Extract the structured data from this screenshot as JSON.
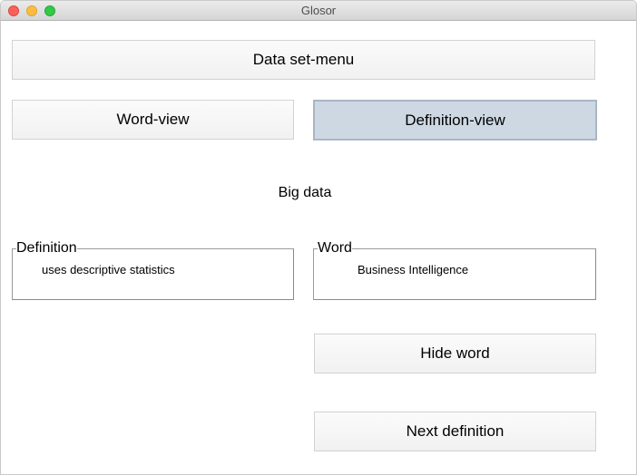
{
  "window": {
    "title": "Glosor"
  },
  "buttons": {
    "data_set_menu": "Data set-menu",
    "word_view": "Word-view",
    "definition_view": "Definition-view",
    "hide_word": "Hide word",
    "next_definition": "Next definition"
  },
  "main": {
    "heading": "Big data",
    "definition_box": {
      "label": "Definition",
      "text": "uses descriptive statistics"
    },
    "word_box": {
      "label": "Word",
      "text": "Business Intelligence"
    }
  },
  "colors": {
    "selected_button_bg": "#cdd8e3",
    "selected_button_border": "#a9b6c4",
    "close_light": "#fc605b",
    "minimize_light": "#fdbc40",
    "maximize_light": "#34c84a"
  }
}
